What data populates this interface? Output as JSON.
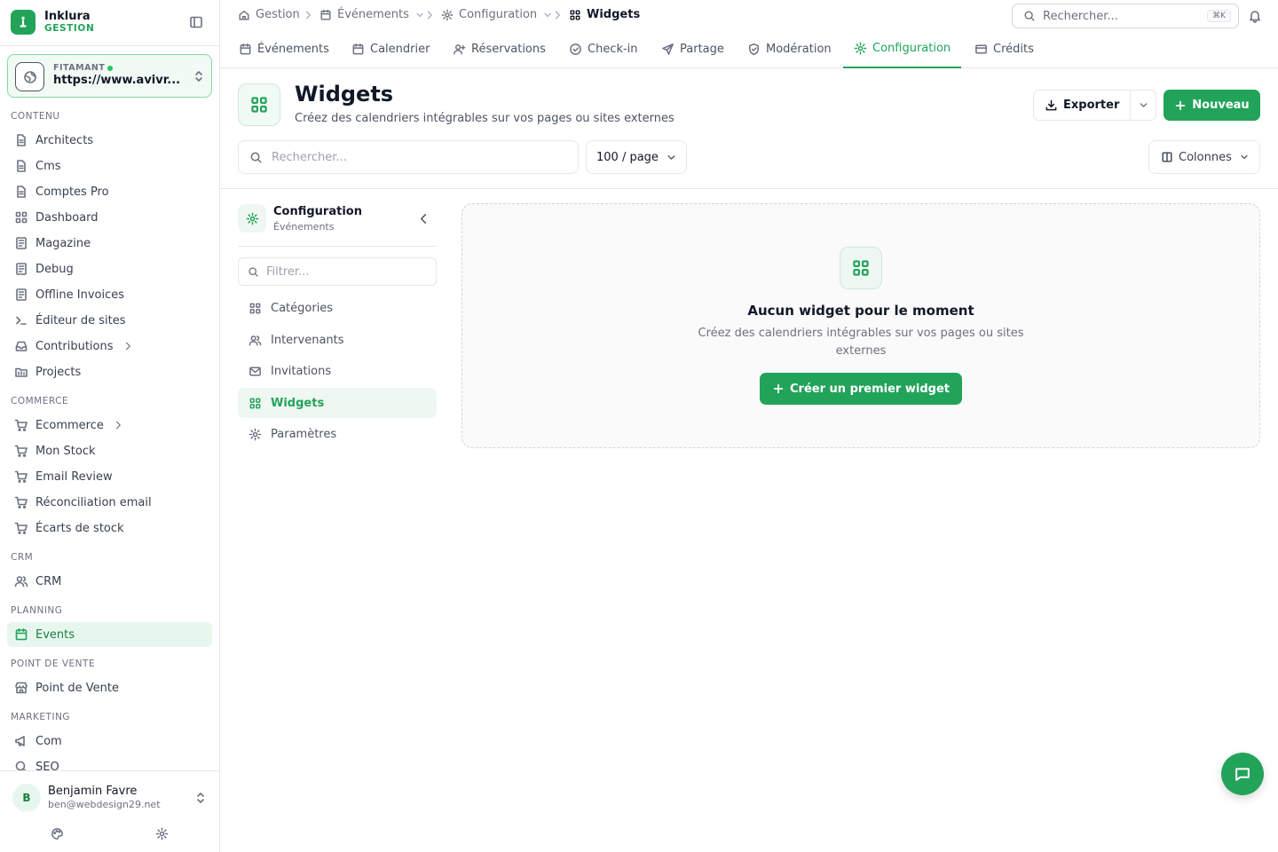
{
  "brand": {
    "name": "Inklura",
    "sub": "GESTION"
  },
  "site": {
    "label": "FITAMANT",
    "url": "https://www.avivr..."
  },
  "sidebar": {
    "sections": [
      {
        "title": "CONTENU",
        "items": [
          {
            "label": "Architects"
          },
          {
            "label": "Cms"
          },
          {
            "label": "Comptes Pro"
          },
          {
            "label": "Dashboard"
          },
          {
            "label": "Magazine"
          },
          {
            "label": "Debug"
          },
          {
            "label": "Offline Invoices"
          },
          {
            "label": "Éditeur de sites"
          },
          {
            "label": "Contributions"
          },
          {
            "label": "Projects"
          }
        ]
      },
      {
        "title": "COMMERCE",
        "items": [
          {
            "label": "Ecommerce"
          },
          {
            "label": "Mon Stock"
          },
          {
            "label": "Email Review"
          },
          {
            "label": "Réconciliation email"
          },
          {
            "label": "Écarts de stock"
          }
        ]
      },
      {
        "title": "CRM",
        "items": [
          {
            "label": "CRM"
          }
        ]
      },
      {
        "title": "PLANNING",
        "items": [
          {
            "label": "Events"
          }
        ]
      },
      {
        "title": "POINT DE VENTE",
        "items": [
          {
            "label": "Point de Vente"
          }
        ]
      },
      {
        "title": "MARKETING",
        "items": [
          {
            "label": "Com"
          },
          {
            "label": "SEO"
          }
        ]
      }
    ]
  },
  "user": {
    "initial": "B",
    "name": "Benjamin Favre",
    "email": "ben@webdesign29.net"
  },
  "breadcrumb": [
    {
      "label": "Gestion"
    },
    {
      "label": "Événements"
    },
    {
      "label": "Configuration"
    },
    {
      "label": "Widgets"
    }
  ],
  "search": {
    "placeholder": "Rechercher...",
    "shortcut": "⌘K"
  },
  "tabs": [
    {
      "label": "Événements"
    },
    {
      "label": "Calendrier"
    },
    {
      "label": "Réservations"
    },
    {
      "label": "Check-in"
    },
    {
      "label": "Partage"
    },
    {
      "label": "Modération"
    },
    {
      "label": "Configuration"
    },
    {
      "label": "Crédits"
    }
  ],
  "page": {
    "title": "Widgets",
    "subtitle": "Créez des calendriers intégrables sur vos pages ou sites externes",
    "export_label": "Exporter",
    "new_label": "Nouveau",
    "search_placeholder": "Rechercher...",
    "per_page": "100 / page",
    "columns_label": "Colonnes"
  },
  "config": {
    "title": "Configuration",
    "subtitle": "Événements",
    "filter_placeholder": "Filtrer...",
    "items": [
      {
        "label": "Catégories"
      },
      {
        "label": "Intervenants"
      },
      {
        "label": "Invitations"
      },
      {
        "label": "Widgets"
      },
      {
        "label": "Paramètres"
      }
    ]
  },
  "empty": {
    "title": "Aucun widget pour le moment",
    "description": "Créez des calendriers intégrables sur vos pages ou sites externes",
    "cta": "Créer un premier widget"
  },
  "colors": {
    "accent": "#22a35a",
    "accent_soft": "#e8f7ee"
  }
}
